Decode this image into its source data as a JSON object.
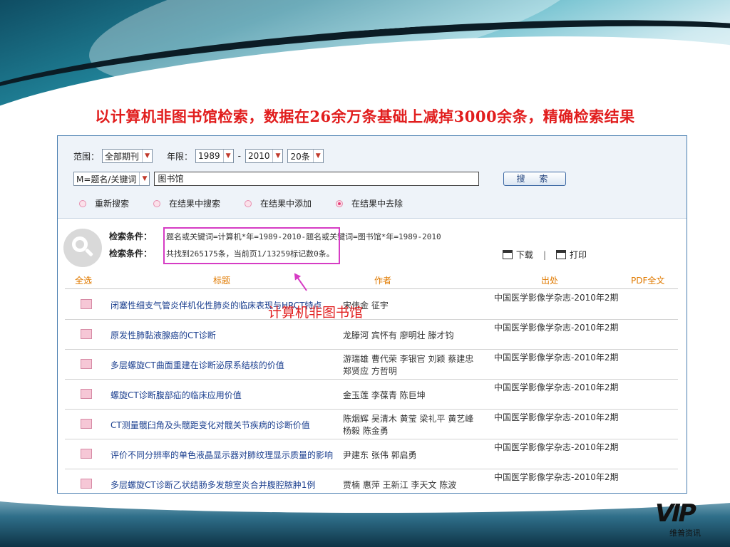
{
  "slide": {
    "title": "以计算机非图书馆检索，数据在26余万条基础上减掉3000余条，精确检索结果",
    "annotation": "计算机非图书馆",
    "logo_mark": "VIP",
    "logo_text": "维普资讯"
  },
  "search": {
    "range_label": "范围：",
    "range_value": "全部期刊",
    "year_label": "年限：",
    "year_from": "1989",
    "year_dash": "-",
    "year_to": "2010",
    "per_page": "20条",
    "field_value": "M=题名/关键词",
    "keyword": "图书馆",
    "search_button": "搜 索",
    "options": [
      {
        "label": "重新搜索",
        "selected": false
      },
      {
        "label": "在结果中搜索",
        "selected": false
      },
      {
        "label": "在结果中添加",
        "selected": false
      },
      {
        "label": "在结果中去除",
        "selected": true
      }
    ]
  },
  "condition": {
    "label1": "检索条件：",
    "value1": "题名或关键词=计算机*年=1989-2010-题名或关键词=图书馆*年=1989-2010",
    "label2": "检索条件：",
    "value2": "共找到265175条，当前页1/13259标记数0条。",
    "download": "下载",
    "divider": "|",
    "print": "打印"
  },
  "table": {
    "headers": {
      "select_all": "全选",
      "title": "标题",
      "author": "作者",
      "source": "出处",
      "pdf": "PDF全文"
    },
    "rows": [
      {
        "title": "闭塞性细支气管炎伴机化性肺炎的临床表现与HRCT特点",
        "author": "宋伟金 征宇",
        "source": "中国医学影像学杂志-2010年2期"
      },
      {
        "title": "原发性肺黏液腺癌的CT诊断",
        "author": "龙滕河 宾怀有 廖明壮 滕才钧",
        "source": "中国医学影像学杂志-2010年2期"
      },
      {
        "title": "多层螺旋CT曲面重建在诊断泌尿系结核的价值",
        "author": "游瑞雄 曹代荣 李银官 刘颖 蔡建忠 郑贤应 方哲明",
        "source": "中国医学影像学杂志-2010年2期"
      },
      {
        "title": "螺旋CT诊断腹部疝的临床应用价值",
        "author": "金玉莲 李葆青 陈巨坤",
        "source": "中国医学影像学杂志-2010年2期"
      },
      {
        "title": "CT测量髋臼角及头髋距变化对髋关节疾病的诊断价值",
        "author": "陈烟辉 吴清木 黄莹 梁礼平 黄艺峰 杨毅 陈金勇",
        "source": "中国医学影像学杂志-2010年2期"
      },
      {
        "title": "评价不同分辨率的单色液晶显示器对肺纹理显示质量的影响",
        "author": "尹建东 张伟 郭启勇",
        "source": "中国医学影像学杂志-2010年2期"
      },
      {
        "title": "多层螺旋CT诊断乙状结肠多发憩室炎合并腹腔脓肿1例",
        "author": "贾楠 惠萍 王新江 李天文 陈波",
        "source": "中国医学影像学杂志-2010年2期"
      }
    ]
  }
}
